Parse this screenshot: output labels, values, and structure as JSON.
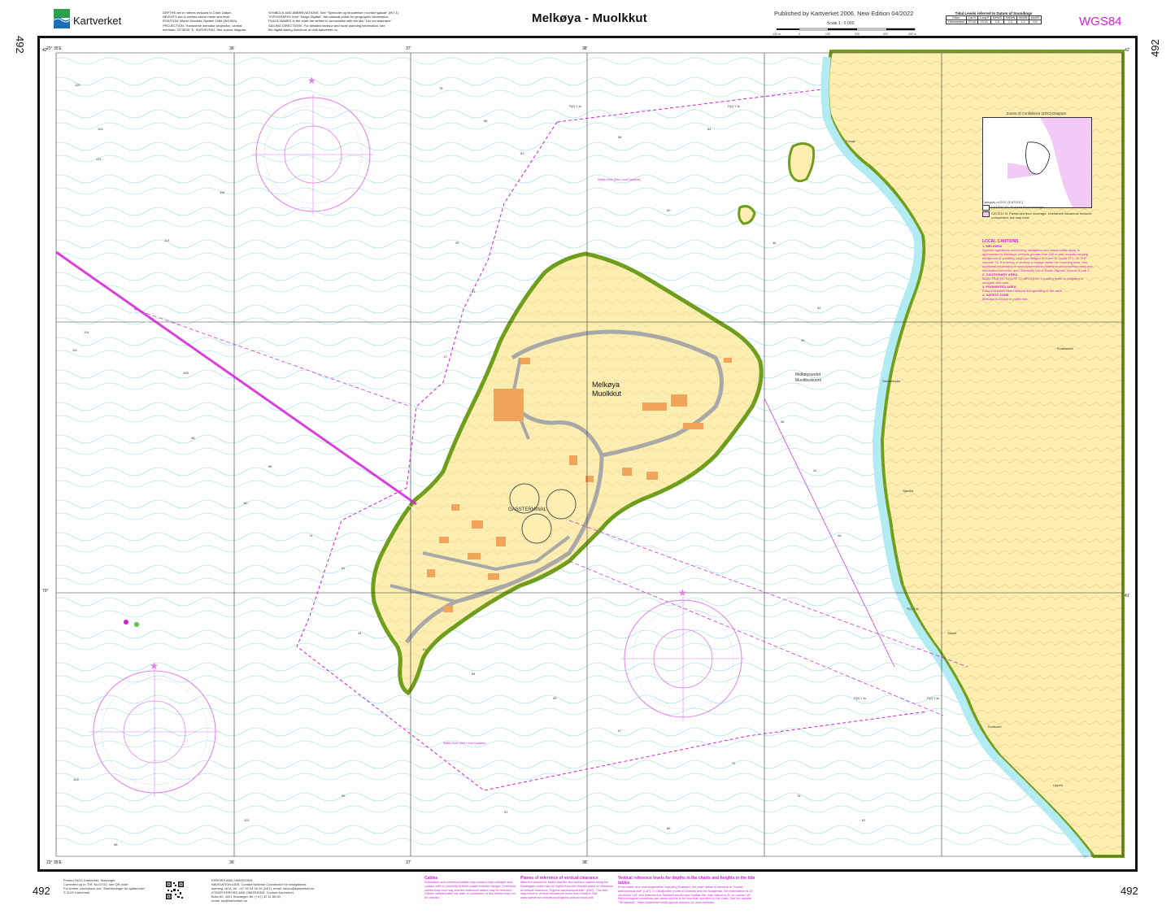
{
  "header": {
    "brand": "Kartverket",
    "title": "Melkøya - Muolkkut",
    "published": "Published by Kartverket 2006, New Edition 04/2022",
    "scale": "Scale 1 : 6 000",
    "datum": "WGS84",
    "chart_number": "492",
    "notes_left": "DEPTHS are in metres reduced to Chart Datum.\nHEIGHTS are in metres above mean sea level.\nPOSITION: World Geodetic System 1984 (WGS84).\nPROJECTION: Transverse mercator projection, central\nmeridian: 23°36'00\" E. SURVEYING: See source diagram.",
    "notes_mid": "SYMBOLS AND ABBREVIATIONS: See \"Symboler og forkortelser i norske sjøkart\" (INT 1).\nTOPOGRAPHY from \"Norge Digitalt\", the national portal for geographic information.\nPLACE NAMES in the chart are written in accordance with the law \"Lov om stadnavn\".\nSAILING DIRECTIONS: For detailed harbour and route planning information, see\nthe digital sailing directions at dnlk.kartverket.no"
  },
  "scale_bar": {
    "labels": [
      "100 m",
      "0",
      "100",
      "200",
      "300",
      "400 m"
    ]
  },
  "tidal_table": {
    "title": "Tidal Levels referred to Datum of Soundings",
    "headers": [
      "Place",
      "Lat N",
      "Long E",
      "MHWS",
      "MHWN",
      "MLWN",
      "MLWS"
    ],
    "row": [
      "Hammerfest",
      "70°40'",
      "23°41'",
      "2.6",
      "2.3",
      "1.1",
      "0.5"
    ]
  },
  "map": {
    "island_name": "Melkøya",
    "island_name_sami": "Muolkkut",
    "terminal": "GASSTERMINAL",
    "sound_name": "Melkøysundet",
    "sound_name_sami": "Muolkkuisuorri",
    "lat_labels": [
      "42'",
      "41'",
      "70°",
      "41'"
    ],
    "lon_labels": [
      "23° 35'E",
      "36'",
      "37'",
      "38'",
      "23° 35'E",
      "36'",
      "37'",
      "38'"
    ],
    "safety_zone_label": "Safety Zone (See Local Cautions)",
    "coastline_names": [
      "Storsteinnes",
      "Sjøvika",
      "Kvalsund",
      "Lippen",
      "Skaidi"
    ],
    "place_names": [
      "Kvalsundet",
      "Forsøl",
      "Melkøya"
    ],
    "lights": [
      "Fl(2) Y 4s",
      "Fl(2) Y 4s",
      "Fl(2) Y 4s",
      "Fl(2) Y 4s",
      "Fl(2) Y 4s"
    ],
    "soundings_left": [
      "119",
      "102",
      "121",
      "115",
      "113",
      "114",
      "108",
      "111",
      "98",
      "88",
      "80",
      "74",
      "61"
    ],
    "soundings_mid": [
      "78",
      "66",
      "61",
      "58",
      "54",
      "50",
      "46",
      "42",
      "39",
      "36",
      "32",
      "28",
      "25",
      "21",
      "17"
    ],
    "soundings_lower": [
      "44",
      "61",
      "64",
      "59",
      "67",
      "72",
      "76",
      "81",
      "86",
      "91",
      "95",
      "101",
      "98",
      "104"
    ]
  },
  "zoc": {
    "title": "Zones of Confidence (ZOC) Diagram",
    "category": "Category of ZOC (CATZOC)",
    "item_a": "CATZOC A1: Full sea floor coverage.",
    "item_b": "CATZOC B: Partial sea floor coverage. Uncharted hazardous features unexpected, but may exist."
  },
  "cautions": {
    "title": "LOCAL CAUTIONS",
    "h1": "1. MELKØYA",
    "p1": "Special regulations concerning navigation and vessel traffic apply to approaches to Melkøya. Vessels greater than 150 m and vessels carrying dangerous or polluting cargo are obliged to report to Vardø VTS, on VHF channel 71. If entering or starting a voyage inside the reporting area. See additional information in www.kystverket.no/Maritime-services/Reporting-and-information-services, and \"Admiralty List of Radio Signals\" volume 6 part 2.",
    "h2": "2. CAUTIONARY AREA",
    "p2": "MAIN TRAFFIC ROUTE TO MELKØYA: Crossing traffic is obligated to navigate with care.",
    "h3": "3. PROHIBITED AREA",
    "p3": "Entry prohibited when tankers are operating in the area.",
    "h4": "4. SAFETY ZONE",
    "p4": "Melkøya is closed to public use."
  },
  "footer": {
    "chart_number": "492",
    "printed": "Printed 04/22 Kartverket, Stavanger.\nCorrected up to \"Eff\" No.07/22, see QR-code.\nFor further corrections see \"Etterretninger for sjøfarende\".\n© 2022 Kartverket",
    "errors": "ERRORS AND OMISSIONS:\nNAVIGATION AIDS: Contact National Coordinator for navigational\nwarning, NCA, tel. +47 32 04 35 20 (24/7), email: navco@kystverket.no\nOTHER ERRORS AND OMISSIONS: Contact Kartverket,\nBoks 60, 4001 Stavanger, tel. (+47) 32 11 80 00,\nemail: sjo@kartverket.no",
    "cables_title": "Cables",
    "cables_body": "Submarine and overhead cables may conduct high voltages and contact with or proximity to them poses extreme danger. Overhead cables may have sag and the clearance stated may be reduced. Cables installed after the date of publication of this edition may not be charted.",
    "planes_title": "Planes of reference of vertical clearance",
    "planes_body": "Mariners should be aware that the sea levels in waters along the Norwegian coast may be higher than the charted plane of reference of vertical clearance \"highest astronomical tide\" (HAT). This fact may result in vertical clearances lower than charted. Ref: www.kartverket.no/tidevann/highest-astronomical-tide",
    "vertical_title": "Vertical reference levels for depths in the charts and heights in the tide tables",
    "vertical_body": "From charts and rearrangements, including Svalbard, the chart datum is identical to \"lowest astronomical tide\" (LAT). In Oslofjorden (north of Drøbak) and the Skagerrak, the chart datum is 30 cm below LAT, and between the Swedish border and Drøbak the chart datum is 20 cm below LAT. Meteorological conditions can cause depths to be less than specified in the chart. See the website \"Se havnivå\", https://kartverket.no/til-sjos/se-havniva for more features."
  }
}
